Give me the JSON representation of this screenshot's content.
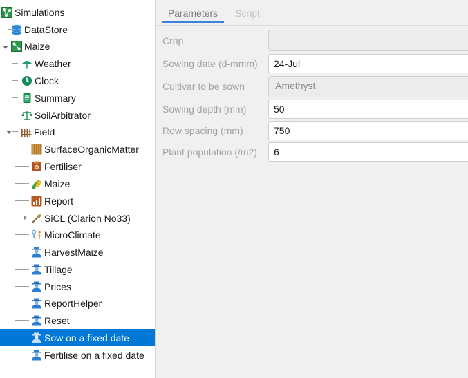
{
  "tree": {
    "nodes": [
      {
        "label": "Simulations",
        "icon": "simulations-icon",
        "selected": false
      },
      {
        "label": "DataStore",
        "icon": "database-icon",
        "selected": false
      },
      {
        "label": "Maize",
        "icon": "simulation-icon",
        "selected": false
      },
      {
        "label": "Weather",
        "icon": "weather-icon",
        "selected": false
      },
      {
        "label": "Clock",
        "icon": "clock-icon",
        "selected": false
      },
      {
        "label": "Summary",
        "icon": "summary-icon",
        "selected": false
      },
      {
        "label": "SoilArbitrator",
        "icon": "scales-icon",
        "selected": false
      },
      {
        "label": "Field",
        "icon": "field-icon",
        "selected": false
      },
      {
        "label": "SurfaceOrganicMatter",
        "icon": "surface-organic-matter-icon",
        "selected": false
      },
      {
        "label": "Fertiliser",
        "icon": "fertiliser-icon",
        "selected": false
      },
      {
        "label": "Maize",
        "icon": "maize-plant-icon",
        "selected": false
      },
      {
        "label": "Report",
        "icon": "report-icon",
        "selected": false
      },
      {
        "label": "SiCL (Clarion No33)",
        "icon": "soil-icon",
        "selected": false
      },
      {
        "label": "MicroClimate",
        "icon": "microclimate-icon",
        "selected": false
      },
      {
        "label": "HarvestMaize",
        "icon": "manager-icon",
        "selected": false
      },
      {
        "label": "Tillage",
        "icon": "manager-icon",
        "selected": false
      },
      {
        "label": "Prices",
        "icon": "manager-icon",
        "selected": false
      },
      {
        "label": "ReportHelper",
        "icon": "manager-icon",
        "selected": false
      },
      {
        "label": "Reset",
        "icon": "manager-icon",
        "selected": false
      },
      {
        "label": "Sow on a fixed date",
        "icon": "manager-icon",
        "selected": true
      },
      {
        "label": "Fertilise on a fixed date",
        "icon": "manager-icon",
        "selected": false
      }
    ]
  },
  "tabs": {
    "parameters": "Parameters",
    "script": "Script"
  },
  "params": [
    {
      "label": "Crop",
      "value": "",
      "editable": false
    },
    {
      "label": "Sowing date (d-mmm)",
      "value": "24-Jul",
      "editable": true
    },
    {
      "label": "Cultivar to be sown",
      "value": "Amethyst",
      "editable": false
    },
    {
      "label": "Sowing depth (mm)",
      "value": "50",
      "editable": true
    },
    {
      "label": "Row spacing (mm)",
      "value": "750",
      "editable": true
    },
    {
      "label": "Plant population (/m2)",
      "value": "6",
      "editable": true
    }
  ],
  "colors": {
    "selection": "#0078d7",
    "tab_underline": "#3d7fd9",
    "panel_bg": "#f0f0f0"
  }
}
